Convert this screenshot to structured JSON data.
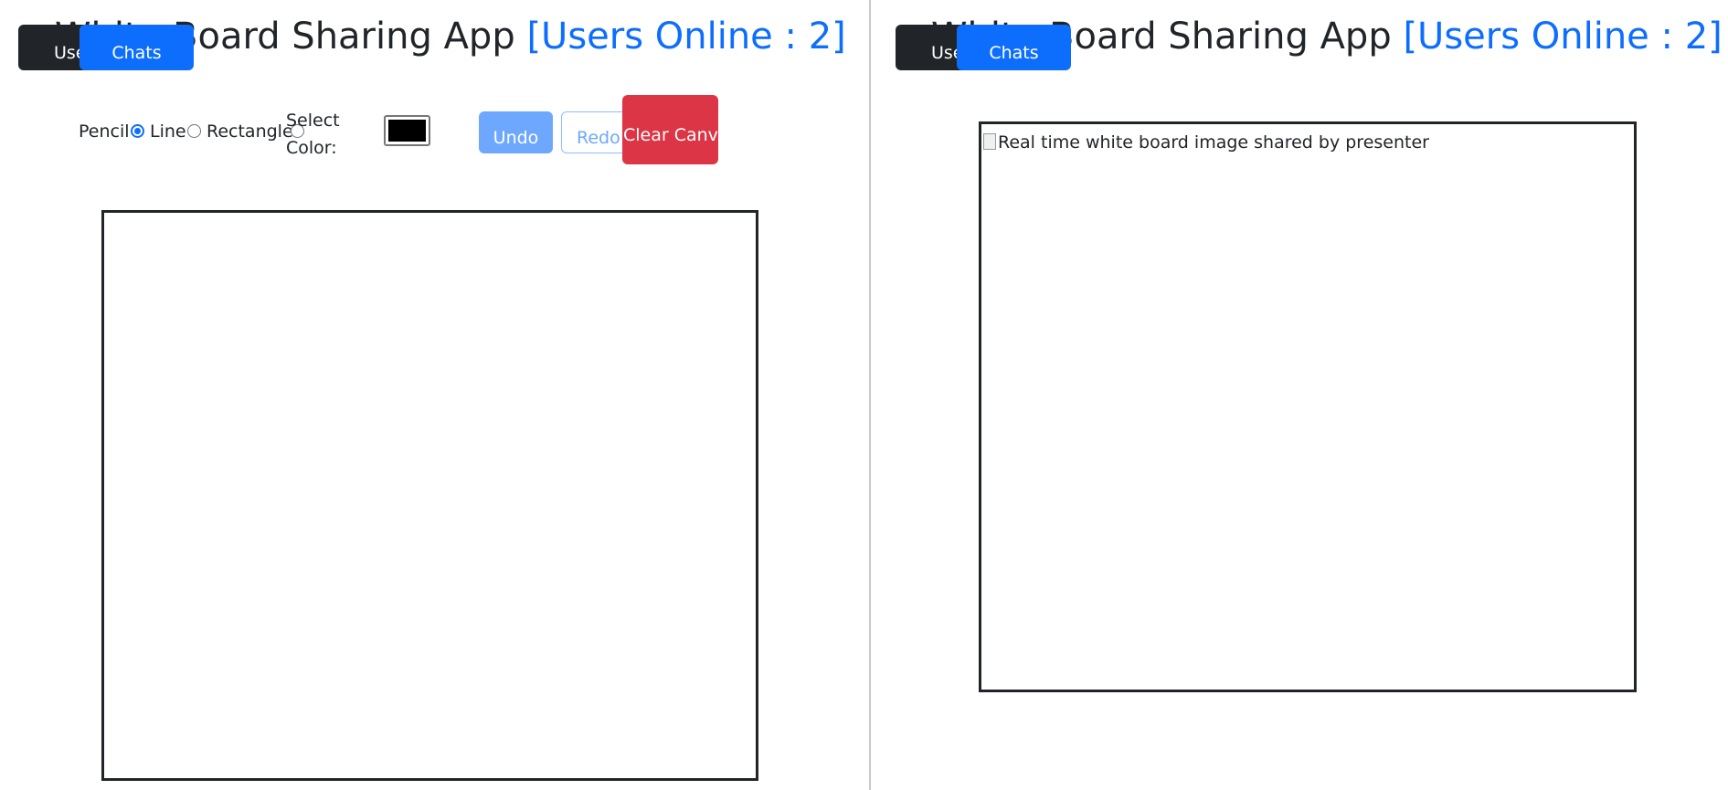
{
  "app": {
    "title": "White Board Sharing App",
    "users_online": "[Users Online : 2]"
  },
  "left": {
    "buttons": {
      "users": "Users",
      "chats": "Chats"
    },
    "tools": {
      "pencil": "Pencil",
      "line": "Line",
      "rectangle": "Rectangle",
      "selected": "pencil"
    },
    "color_label": "Select Color:",
    "color_value": "#000000",
    "undo": "Undo",
    "redo": "Redo",
    "clear": "Clear Canvas"
  },
  "right": {
    "buttons": {
      "users": "Users",
      "chats": "Chats"
    },
    "board_alt": "Real time white board image shared by presenter"
  },
  "colors": {
    "primary": "#0d6efd",
    "dark": "#212529",
    "danger": "#dc3545",
    "primary_light": "#6ea8fe"
  }
}
